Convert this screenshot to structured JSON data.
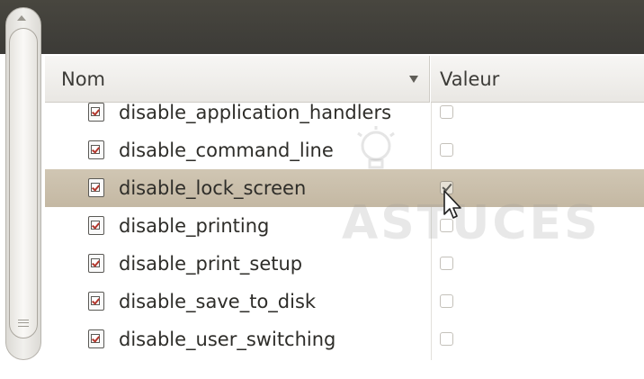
{
  "columns": {
    "name": "Nom",
    "value": "Valeur"
  },
  "rows": [
    {
      "label": "disable_application_handlers",
      "checked": false,
      "selected": false
    },
    {
      "label": "disable_command_line",
      "checked": false,
      "selected": false
    },
    {
      "label": "disable_lock_screen",
      "checked": true,
      "selected": true
    },
    {
      "label": "disable_printing",
      "checked": false,
      "selected": false
    },
    {
      "label": "disable_print_setup",
      "checked": false,
      "selected": false
    },
    {
      "label": "disable_save_to_disk",
      "checked": false,
      "selected": false
    },
    {
      "label": "disable_user_switching",
      "checked": false,
      "selected": false
    }
  ],
  "watermark": "ASTUCES",
  "colors": {
    "titlebar": "#3c3b37",
    "selected_row": "#c9bea9",
    "check_accent": "#b2362c"
  }
}
